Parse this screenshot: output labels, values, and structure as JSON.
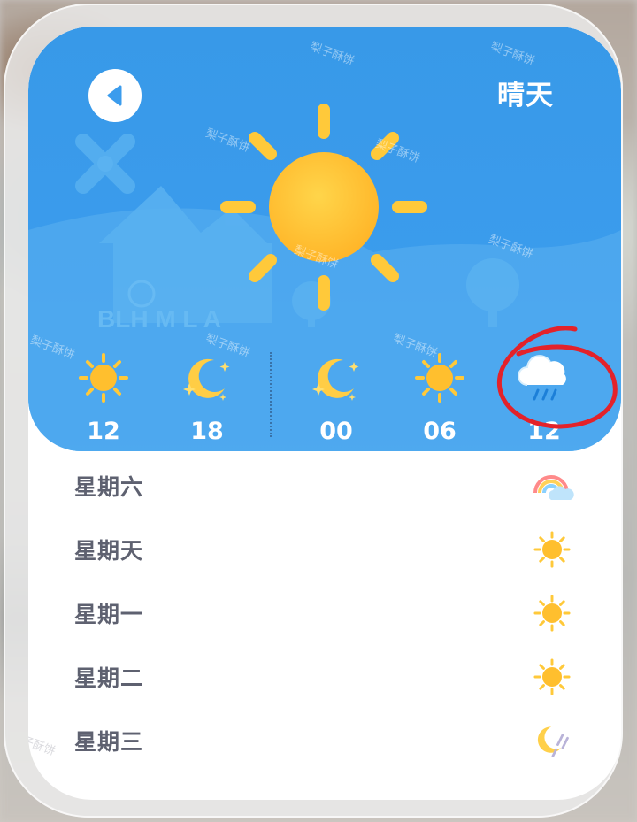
{
  "header": {
    "condition": "晴天",
    "back_icon": "back-arrow-icon",
    "main_icon": "sun-icon"
  },
  "hourly": [
    {
      "time": "12",
      "icon": "sun-icon"
    },
    {
      "time": "18",
      "icon": "moon-stars-icon"
    },
    {
      "time": "00",
      "icon": "moon-stars-icon"
    },
    {
      "time": "06",
      "icon": "sun-icon"
    },
    {
      "time": "12",
      "icon": "cloud-rain-icon"
    }
  ],
  "days": [
    {
      "name": "星期六",
      "icon": "rainbow-cloud-icon"
    },
    {
      "name": "星期天",
      "icon": "sun-icon"
    },
    {
      "name": "星期一",
      "icon": "sun-icon"
    },
    {
      "name": "星期二",
      "icon": "sun-icon"
    },
    {
      "name": "星期三",
      "icon": "moon-rain-icon"
    }
  ],
  "watermark": "梨子酥饼",
  "colors": {
    "header_blue": "#3b9ced",
    "sun_yellow": "#ffc93a",
    "annotation_red": "#e3222a",
    "day_text": "#5e6170"
  }
}
